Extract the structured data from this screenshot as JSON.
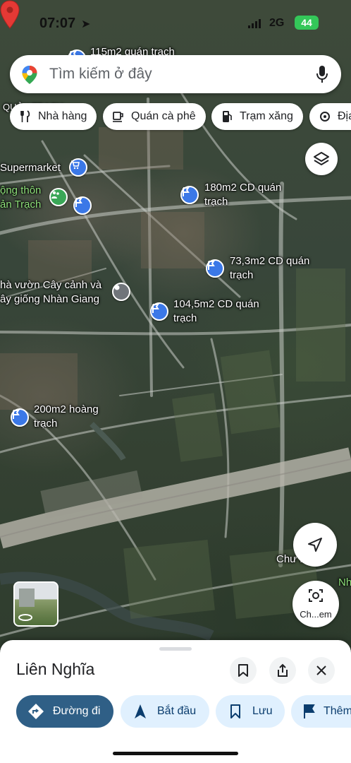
{
  "status_bar": {
    "time": "07:07",
    "network": "2G",
    "battery": "44"
  },
  "search": {
    "placeholder": "Tìm kiếm ở đây"
  },
  "chips": [
    {
      "label": "Nhà hàng",
      "icon": "fork-knife-icon"
    },
    {
      "label": "Quán cà phê",
      "icon": "coffee-cup-icon"
    },
    {
      "label": "Trạm xăng",
      "icon": "gas-pump-icon"
    },
    {
      "label": "Địa",
      "icon": "place-icon"
    }
  ],
  "map_labels": {
    "top_listing": "115m2 quán trạch",
    "quan_trach_cut": "QUẢN TRẠCH",
    "supermarket": "Supermarket",
    "village_line1": "ộng thôn",
    "village_line2": "ản Trạch",
    "listing_180_line1": "180m2 CD quán",
    "listing_180_line2": "trạch",
    "listing_73_line1": "73,3m2 CD quán",
    "listing_73_line2": "trạch",
    "garden_line1": "hà vườn Cây cảnh và",
    "garden_line2": "ây giống Nhàn Giang",
    "listing_104_line1": "104,5m2 CD quán",
    "listing_104_line2": "trạch",
    "listing_200_line1": "200m2 hoàng",
    "listing_200_line2": "trạch",
    "right_edge_label": "Chư    ng Ph",
    "right_edge_green": "Nh"
  },
  "controls": {
    "lens_label": "Ch...em"
  },
  "sheet": {
    "title": "Liên Nghĩa",
    "actions": [
      {
        "label": "Đường đi",
        "icon": "directions-icon"
      },
      {
        "label": "Bắt đầu",
        "icon": "navigation-arrow-icon"
      },
      {
        "label": "Lưu",
        "icon": "bookmark-icon"
      },
      {
        "label": "Thêm",
        "icon": "flag-icon"
      }
    ]
  },
  "colors": {
    "accent_blue": "#3b78e7",
    "primary_action": "#2f5f86",
    "secondary_action_bg": "#e0f0fe",
    "pin_red": "#e53935",
    "battery_green": "#34c759"
  }
}
